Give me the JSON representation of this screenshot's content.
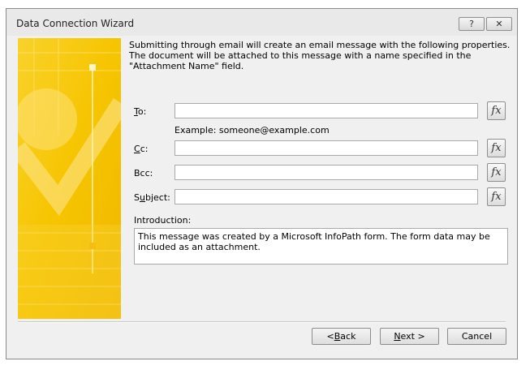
{
  "window": {
    "title": "Data Connection Wizard",
    "help_label": "?",
    "close_label": "✕"
  },
  "description": "Submitting through email will create an email message with the following properties. The document will be attached to this message with a name specified in the \"Attachment Name\" field.",
  "fields": {
    "to": {
      "label_key": "T",
      "label_rest": "o:",
      "value": "",
      "fx": "fx"
    },
    "example": "Example: someone@example.com",
    "cc": {
      "label_key": "C",
      "label_rest": "c:",
      "value": "",
      "fx": "fx"
    },
    "bcc": {
      "label": "Bcc:",
      "value": "",
      "fx": "fx"
    },
    "subject": {
      "label_pre": "S",
      "label_key": "u",
      "label_rest": "bject:",
      "value": "",
      "fx": "fx"
    },
    "introduction": {
      "label": "Introduction:",
      "value": "This message was created by a Microsoft InfoPath form. The form data may be included as an attachment."
    }
  },
  "buttons": {
    "back": {
      "pre": "< ",
      "key": "B",
      "rest": "ack"
    },
    "next": {
      "key": "N",
      "rest": "ext >"
    },
    "cancel": "Cancel"
  },
  "colors": {
    "accent": "#f5c400",
    "window_bg": "#f0f0f0"
  }
}
